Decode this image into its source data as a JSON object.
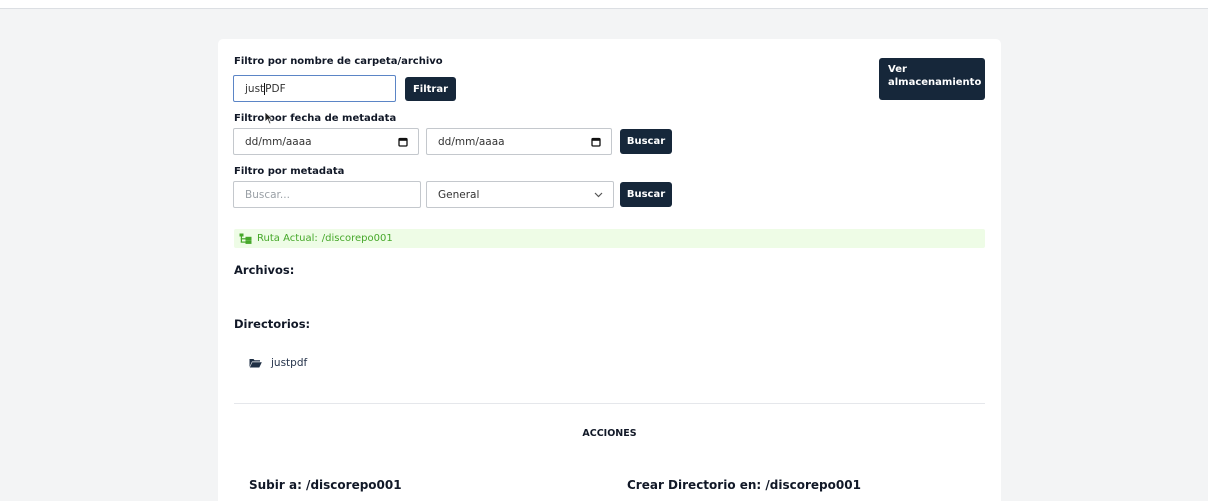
{
  "filters": {
    "name_label": "Filtro por nombre de carpeta/archivo",
    "name_value_typed": "just",
    "name_value_rest": "PDF",
    "filter_button": "Filtrar",
    "date_label": "Filtro por fecha de metadata",
    "date_from_placeholder": "dd/mm/aaaa",
    "date_to_placeholder": "dd/mm/aaaa",
    "date_search_button": "Buscar",
    "metadata_label": "Filtro por metadata",
    "metadata_placeholder": "Buscar...",
    "metadata_select_value": "General",
    "metadata_search_button": "Buscar"
  },
  "storage_button": {
    "line1": "Ver",
    "line2": "almacenamiento"
  },
  "path": {
    "label": "Ruta Actual:",
    "value": "/discorepo001"
  },
  "files": {
    "title": "Archivos:"
  },
  "directories": {
    "title": "Directorios:",
    "items": [
      {
        "name": "justpdf",
        "icon": "folder-open-icon"
      }
    ]
  },
  "actions": {
    "title": "ACCIONES",
    "upload_title": "Subir a: /discorepo001",
    "create_dir_title": "Crear Directorio en: /discorepo001"
  },
  "colors": {
    "primary_button": "#16273a",
    "path_bar_bg": "#eefce6",
    "path_text": "#46a82a",
    "page_bg": "#f3f4f5"
  }
}
